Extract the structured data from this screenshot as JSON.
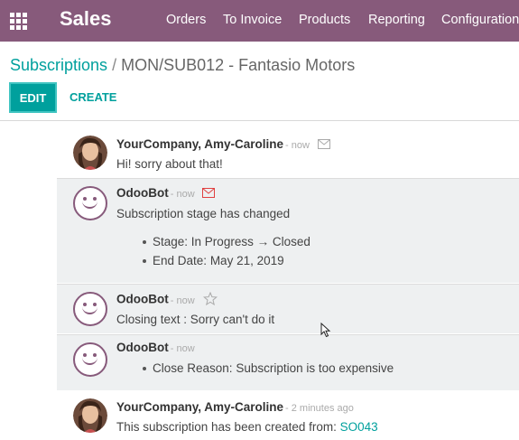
{
  "navbar": {
    "brand": "Sales",
    "menu": [
      "Orders",
      "To Invoice",
      "Products",
      "Reporting",
      "Configuration"
    ],
    "color": "#875a7b"
  },
  "breadcrumb": {
    "parent": "Subscriptions",
    "separator": "/",
    "current": "MON/SUB012 - Fantasio Motors"
  },
  "buttons": {
    "edit": "EDIT",
    "create": "CREATE",
    "accent": "#00a09d"
  },
  "messages": [
    {
      "author": "YourCompany, Amy-Caroline",
      "date": "- now",
      "icon": "envelope-icon",
      "body": "Hi! sorry about that!"
    },
    {
      "author": "OdooBot",
      "date": "- now",
      "icon": "envelope-icon",
      "body": "Subscription stage has changed",
      "tracking": [
        {
          "label": "Stage:",
          "old": "In Progress",
          "arrow": "→",
          "new": "Closed"
        },
        {
          "label": "End Date:",
          "value": "May 21, 2019"
        }
      ]
    },
    {
      "author": "OdooBot",
      "date": "- now",
      "icon": "star-icon",
      "body": "Closing text : Sorry can't do it"
    },
    {
      "author": "OdooBot",
      "date": "- now",
      "tracking": [
        {
          "label": "Close Reason:",
          "value": "Subscription is too expensive"
        }
      ]
    },
    {
      "author": "YourCompany, Amy-Caroline",
      "date": "- 2 minutes ago",
      "body": "This subscription has been created from:",
      "link": "SO043"
    }
  ]
}
